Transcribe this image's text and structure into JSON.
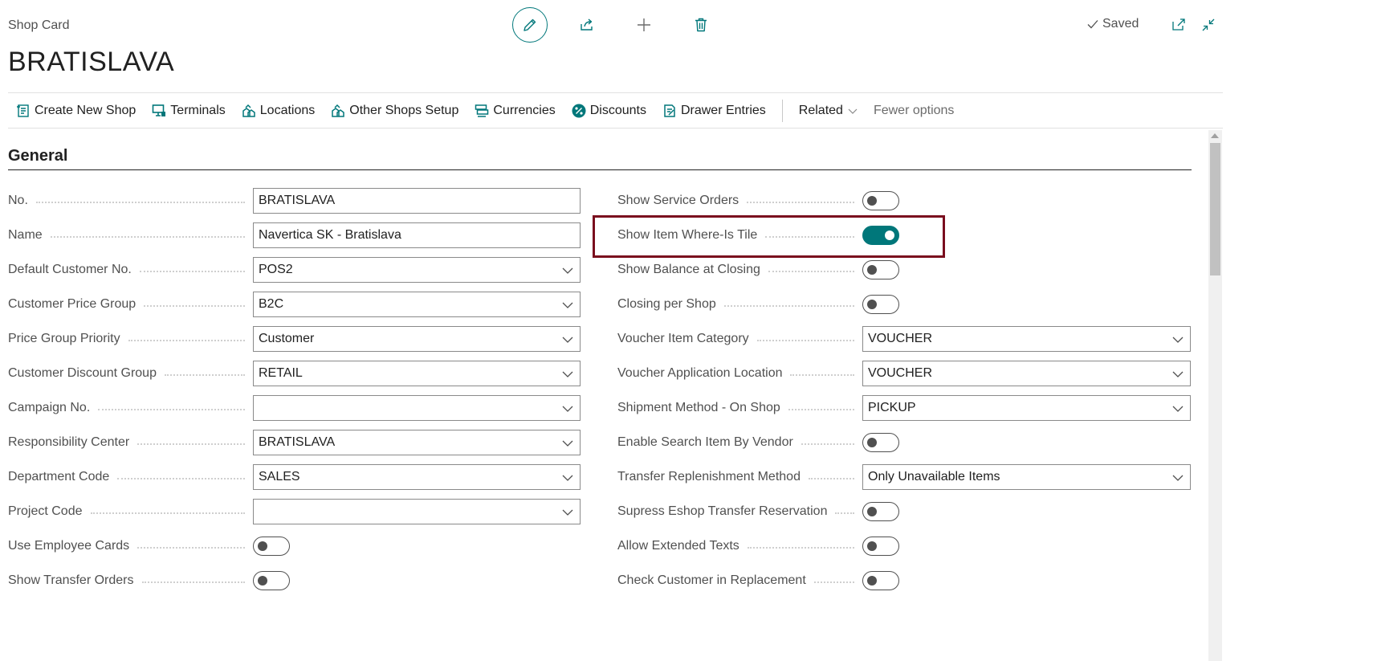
{
  "header": {
    "caption": "Shop Card",
    "title": "BRATISLAVA",
    "saved_label": "Saved"
  },
  "actionbar": {
    "items": [
      {
        "label": "Create New Shop",
        "icon": "create-new-icon"
      },
      {
        "label": "Terminals",
        "icon": "terminal-icon"
      },
      {
        "label": "Locations",
        "icon": "location-icon"
      },
      {
        "label": "Other Shops Setup",
        "icon": "shops-setup-icon"
      },
      {
        "label": "Currencies",
        "icon": "currency-icon"
      },
      {
        "label": "Discounts",
        "icon": "percent-icon"
      },
      {
        "label": "Drawer Entries",
        "icon": "drawer-entries-icon"
      }
    ],
    "related": "Related",
    "fewer": "Fewer options"
  },
  "section": {
    "title": "General"
  },
  "left_fields": [
    {
      "label": "No.",
      "type": "text",
      "value": "BRATISLAVA"
    },
    {
      "label": "Name",
      "type": "text",
      "value": "Navertica SK - Bratislava"
    },
    {
      "label": "Default Customer No.",
      "type": "select",
      "value": "POS2"
    },
    {
      "label": "Customer Price Group",
      "type": "select",
      "value": "B2C"
    },
    {
      "label": "Price Group Priority",
      "type": "select",
      "value": "Customer"
    },
    {
      "label": "Customer Discount Group",
      "type": "select",
      "value": "RETAIL"
    },
    {
      "label": "Campaign No.",
      "type": "select",
      "value": ""
    },
    {
      "label": "Responsibility Center",
      "type": "select",
      "value": "BRATISLAVA"
    },
    {
      "label": "Department Code",
      "type": "select",
      "value": "SALES"
    },
    {
      "label": "Project Code",
      "type": "select",
      "value": ""
    },
    {
      "label": "Use Employee Cards",
      "type": "toggle",
      "on": false
    },
    {
      "label": "Show Transfer Orders",
      "type": "toggle",
      "on": false
    }
  ],
  "right_fields": [
    {
      "label": "Show Service Orders",
      "type": "toggle",
      "on": false
    },
    {
      "label": "Show Item Where-Is Tile",
      "type": "toggle",
      "on": true
    },
    {
      "label": "Show Balance at Closing",
      "type": "toggle",
      "on": false
    },
    {
      "label": "Closing per Shop",
      "type": "toggle",
      "on": false
    },
    {
      "label": "Voucher Item Category",
      "type": "select",
      "value": "VOUCHER"
    },
    {
      "label": "Voucher Application Location",
      "type": "select",
      "value": "VOUCHER"
    },
    {
      "label": "Shipment Method - On Shop",
      "type": "select",
      "value": "PICKUP"
    },
    {
      "label": "Enable Search Item By Vendor",
      "type": "toggle",
      "on": false
    },
    {
      "label": "Transfer Replenishment Method",
      "type": "select",
      "value": "Only Unavailable Items"
    },
    {
      "label": "Supress Eshop Transfer Reservation",
      "type": "toggle",
      "on": false
    },
    {
      "label": "Allow Extended Texts",
      "type": "toggle",
      "on": false
    },
    {
      "label": "Check Customer in Replacement",
      "type": "toggle",
      "on": false
    }
  ],
  "colors": {
    "accent": "#00777a",
    "highlight": "#7a0e1e"
  }
}
